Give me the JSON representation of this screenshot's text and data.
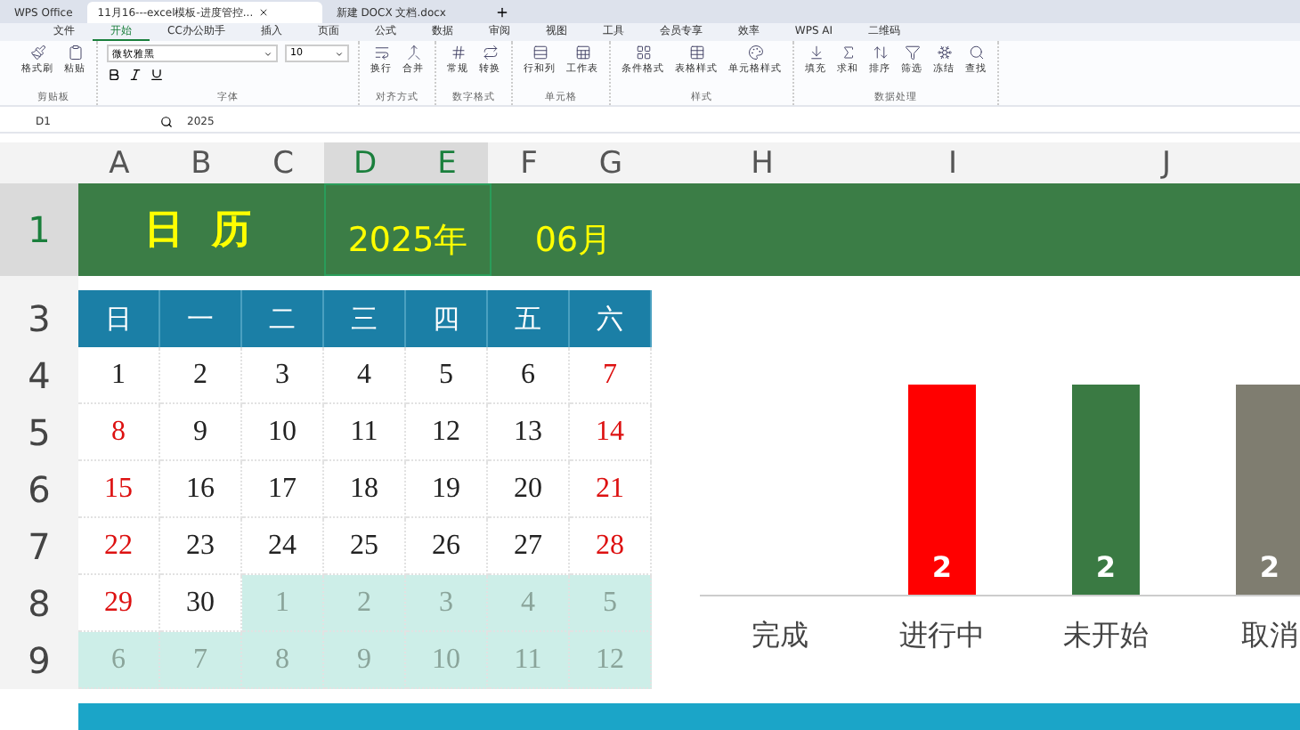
{
  "browser_tabs": [
    {
      "label": "WPS Office",
      "selected": false
    },
    {
      "label": "11月16---excel模板-进度管控...",
      "selected": true
    },
    {
      "label": "新建 DOCX 文档.docx",
      "selected": false
    }
  ],
  "menu_tabs": [
    {
      "label": "文件",
      "selected": false
    },
    {
      "label": "开始",
      "selected": true
    },
    {
      "label": "CC办公助手",
      "selected": false
    },
    {
      "label": "插入",
      "selected": false
    },
    {
      "label": "页面",
      "selected": false
    },
    {
      "label": "公式",
      "selected": false
    },
    {
      "label": "数据",
      "selected": false
    },
    {
      "label": "审阅",
      "selected": false
    },
    {
      "label": "视图",
      "selected": false
    },
    {
      "label": "工具",
      "selected": false
    },
    {
      "label": "会员专享",
      "selected": false
    },
    {
      "label": "效率",
      "selected": false
    },
    {
      "label": "WPS AI",
      "selected": false
    },
    {
      "label": "二维码",
      "selected": false
    }
  ],
  "ribbon_groups": [
    {
      "kind": "buttons",
      "label": "剪贴板",
      "buttons": [
        "格式刷",
        "粘贴"
      ]
    },
    {
      "kind": "font",
      "label": "字体",
      "font": "微软雅黑",
      "size": "10"
    },
    {
      "kind": "buttons",
      "label": "对齐方式",
      "buttons": [
        "换行",
        "合并"
      ]
    },
    {
      "kind": "buttons",
      "label": "数字格式",
      "buttons": [
        "常规",
        "转换"
      ]
    },
    {
      "kind": "buttons",
      "label": "单元格",
      "buttons": [
        "行和列",
        "工作表"
      ]
    },
    {
      "kind": "buttons",
      "label": "样式",
      "buttons": [
        "条件格式",
        "表格样式",
        "单元格样式"
      ]
    },
    {
      "kind": "buttons",
      "label": "数据处理",
      "buttons": [
        "填充",
        "求和",
        "排序",
        "筛选",
        "冻结",
        "查找"
      ]
    }
  ],
  "name_box": "D1",
  "formula": "2025",
  "columns": [
    {
      "label": "A",
      "selected": false
    },
    {
      "label": "B",
      "selected": false
    },
    {
      "label": "C",
      "selected": false
    },
    {
      "label": "D",
      "selected": true
    },
    {
      "label": "E",
      "selected": true
    },
    {
      "label": "F",
      "selected": false
    },
    {
      "label": "G",
      "selected": false
    },
    {
      "label": "H",
      "selected": false
    },
    {
      "label": "I",
      "selected": false
    },
    {
      "label": "J",
      "selected": false
    }
  ],
  "row_labels": [
    "1",
    "3",
    "4",
    "5",
    "6",
    "7",
    "8",
    "9"
  ],
  "title": {
    "text": "日 历",
    "year": "2025年",
    "month": "06月"
  },
  "calendar": {
    "weekdays": [
      "日",
      "一",
      "二",
      "三",
      "四",
      "五",
      "六"
    ],
    "weeks": [
      [
        {
          "day": "1",
          "other_month": false,
          "color": "#222222"
        },
        {
          "day": "2",
          "other_month": false,
          "color": "#222222"
        },
        {
          "day": "3",
          "other_month": false,
          "color": "#222222"
        },
        {
          "day": "4",
          "other_month": false,
          "color": "#222222"
        },
        {
          "day": "5",
          "other_month": false,
          "color": "#222222"
        },
        {
          "day": "6",
          "other_month": false,
          "color": "#222222"
        },
        {
          "day": "7",
          "other_month": false,
          "color": "#dd1111"
        }
      ],
      [
        {
          "day": "8",
          "other_month": false,
          "color": "#dd1111"
        },
        {
          "day": "9",
          "other_month": false,
          "color": "#222222"
        },
        {
          "day": "10",
          "other_month": false,
          "color": "#222222"
        },
        {
          "day": "11",
          "other_month": false,
          "color": "#222222"
        },
        {
          "day": "12",
          "other_month": false,
          "color": "#222222"
        },
        {
          "day": "13",
          "other_month": false,
          "color": "#222222"
        },
        {
          "day": "14",
          "other_month": false,
          "color": "#dd1111"
        }
      ],
      [
        {
          "day": "15",
          "other_month": false,
          "color": "#dd1111"
        },
        {
          "day": "16",
          "other_month": false,
          "color": "#222222"
        },
        {
          "day": "17",
          "other_month": false,
          "color": "#222222"
        },
        {
          "day": "18",
          "other_month": false,
          "color": "#222222"
        },
        {
          "day": "19",
          "other_month": false,
          "color": "#222222"
        },
        {
          "day": "20",
          "other_month": false,
          "color": "#222222"
        },
        {
          "day": "21",
          "other_month": false,
          "color": "#dd1111"
        }
      ],
      [
        {
          "day": "22",
          "other_month": false,
          "color": "#dd1111"
        },
        {
          "day": "23",
          "other_month": false,
          "color": "#222222"
        },
        {
          "day": "24",
          "other_month": false,
          "color": "#222222"
        },
        {
          "day": "25",
          "other_month": false,
          "color": "#222222"
        },
        {
          "day": "26",
          "other_month": false,
          "color": "#222222"
        },
        {
          "day": "27",
          "other_month": false,
          "color": "#222222"
        },
        {
          "day": "28",
          "other_month": false,
          "color": "#dd1111"
        }
      ],
      [
        {
          "day": "29",
          "other_month": false,
          "color": "#dd1111"
        },
        {
          "day": "30",
          "other_month": false,
          "color": "#222222"
        },
        {
          "day": "1",
          "other_month": true,
          "color": "#8aa49a"
        },
        {
          "day": "2",
          "other_month": true,
          "color": "#8aa49a"
        },
        {
          "day": "3",
          "other_month": true,
          "color": "#8aa49a"
        },
        {
          "day": "4",
          "other_month": true,
          "color": "#8aa49a"
        },
        {
          "day": "5",
          "other_month": true,
          "color": "#8aa49a"
        }
      ],
      [
        {
          "day": "6",
          "other_month": true,
          "color": "#8aa49a"
        },
        {
          "day": "7",
          "other_month": true,
          "color": "#8aa49a"
        },
        {
          "day": "8",
          "other_month": true,
          "color": "#8aa49a"
        },
        {
          "day": "9",
          "other_month": true,
          "color": "#8aa49a"
        },
        {
          "day": "10",
          "other_month": true,
          "color": "#8aa49a"
        },
        {
          "day": "11",
          "other_month": true,
          "color": "#8aa49a"
        },
        {
          "day": "12",
          "other_month": true,
          "color": "#8aa49a"
        }
      ]
    ]
  },
  "chart_data": {
    "type": "bar",
    "categories": [
      "完成",
      "进行中",
      "未开始",
      "取消"
    ],
    "data_labels": true,
    "values": [
      null,
      2,
      2,
      2
    ]
  }
}
